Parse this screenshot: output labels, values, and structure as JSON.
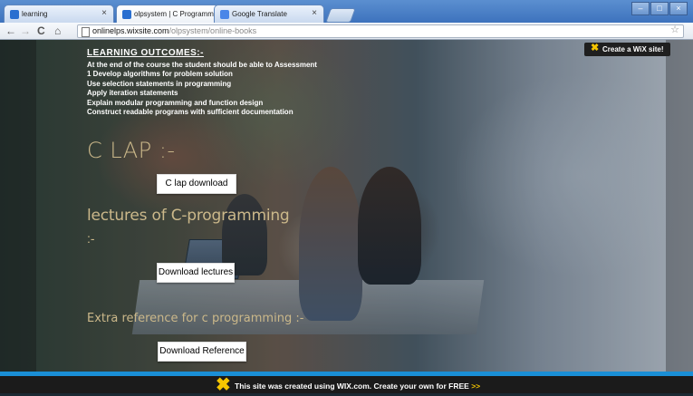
{
  "browser": {
    "tabs": [
      {
        "title": "learning",
        "close": "×",
        "favicon_color": "#2a6fd0",
        "active": false
      },
      {
        "title": "olpsystem | C Programming",
        "close": "×",
        "favicon_color": "#2a6fd0",
        "active": true
      },
      {
        "title": "Google Translate",
        "close": "×",
        "favicon_color": "#4a86e8",
        "active": false
      }
    ],
    "window_controls": [
      "–",
      "□",
      "×"
    ],
    "nav": {
      "back": "←",
      "forward": "→",
      "reload": "C",
      "home": "⌂"
    },
    "url": {
      "host": "onlinelps.wixsite.com",
      "path": "/olpsystem/online-books"
    },
    "star": "☆"
  },
  "wix_badge": {
    "mark": "✖",
    "label": "Create a WiX site!"
  },
  "learning_outcomes": {
    "heading": "LEARNING OUTCOMES:-",
    "lines": [
      "At the end of the course the student should be able to Assessment",
      "1 Develop algorithms for problem solution",
      "Use selection statements in programming",
      "Apply iteration statements",
      "Explain modular programming and function design",
      "Construct readable programs with sufficient documentation"
    ]
  },
  "sections": {
    "clap": {
      "heading": "C LAP :-",
      "button": "C lap download"
    },
    "lectures": {
      "heading": "lectures of C-programming",
      "heading_suffix": ":-",
      "button": "Download lectures"
    },
    "extra": {
      "heading": "Extra reference for c programming :-",
      "button": "Download Reference"
    }
  },
  "footer": {
    "mark": "✖",
    "text": "This site was created using WIX.com. Create your own for FREE",
    "cta": ">>"
  },
  "colors": {
    "accent_gold": "#cbb88a",
    "wix_yellow": "#f5c500",
    "footer_stripe": "#1a8fd6",
    "footer_bg": "#1b1b1b"
  }
}
